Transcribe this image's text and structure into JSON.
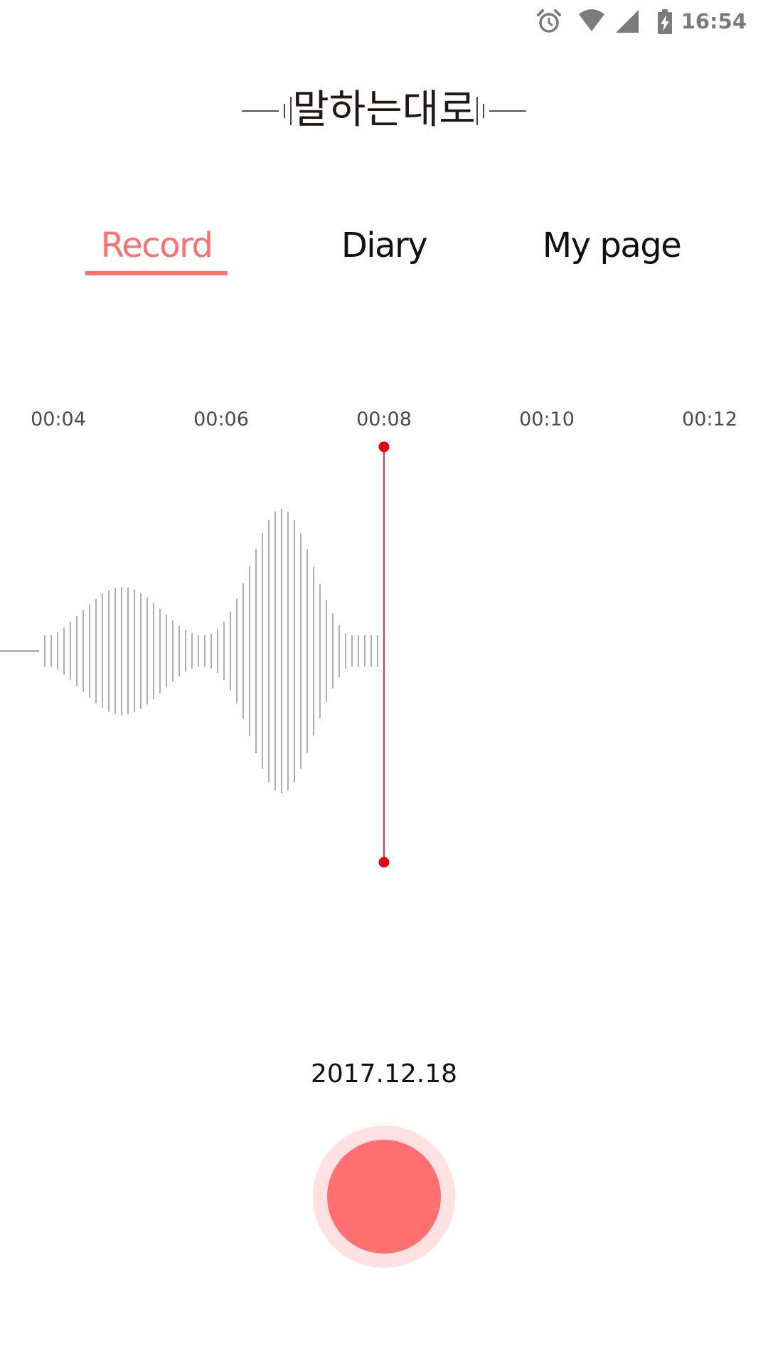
{
  "status_bar": {
    "time": "16:54",
    "icons": [
      "alarm-icon",
      "wifi-icon",
      "cell-signal-icon",
      "battery-charging-icon"
    ],
    "icon_color": "#7b7b7b"
  },
  "app": {
    "title": "말하는대로"
  },
  "tabs": [
    {
      "label": "Record",
      "active": true
    },
    {
      "label": "Diary",
      "active": false
    },
    {
      "label": "My page",
      "active": false
    }
  ],
  "timeline": {
    "labels": [
      "00:04",
      "00:06",
      "00:08",
      "00:10",
      "00:12"
    ],
    "playhead_time": "00:08"
  },
  "recording": {
    "date": "2017.12.18"
  },
  "colors": {
    "accent": "#ff6f70",
    "accent_light": "#ffe1e1",
    "playhead": "#e60012",
    "waveform": "#8c8c8c",
    "text": "#111111"
  }
}
